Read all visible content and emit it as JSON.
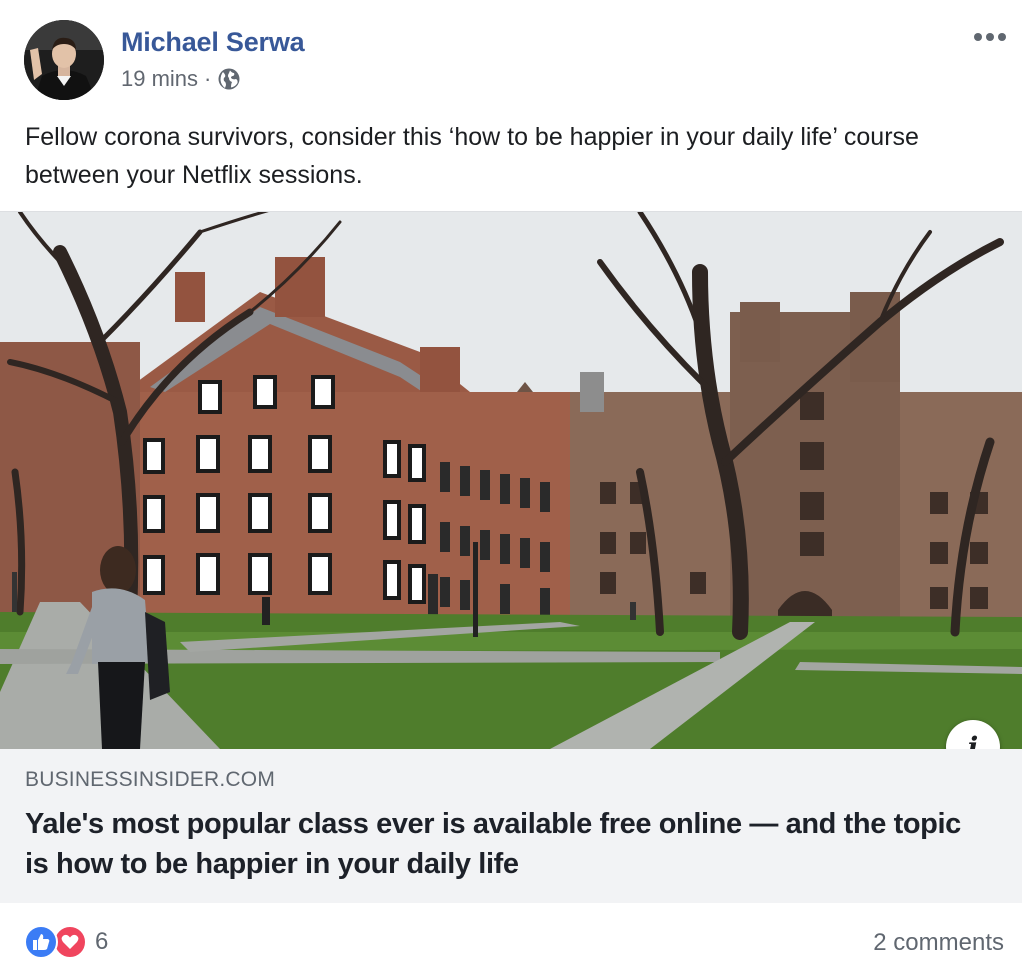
{
  "post": {
    "author": "Michael Serwa",
    "time": "19 mins",
    "separator": "·",
    "audience_icon": "globe-icon",
    "text": "Fellow corona survivors, consider this ‘how to be happier in your daily life’ course between your Netflix sessions."
  },
  "link": {
    "domain": "BUSINESSINSIDER.COM",
    "headline": "Yale's most popular class ever is available free online — and the topic is how to be happier in your daily life",
    "info_label": "i"
  },
  "footer": {
    "reaction_icons": [
      "like-icon",
      "love-icon"
    ],
    "reaction_count": "6",
    "comments": "2 comments"
  },
  "colors": {
    "author_link": "#385898",
    "like": "#3b7cf5",
    "love": "#f0455e",
    "card_bg": "#f2f3f5"
  }
}
